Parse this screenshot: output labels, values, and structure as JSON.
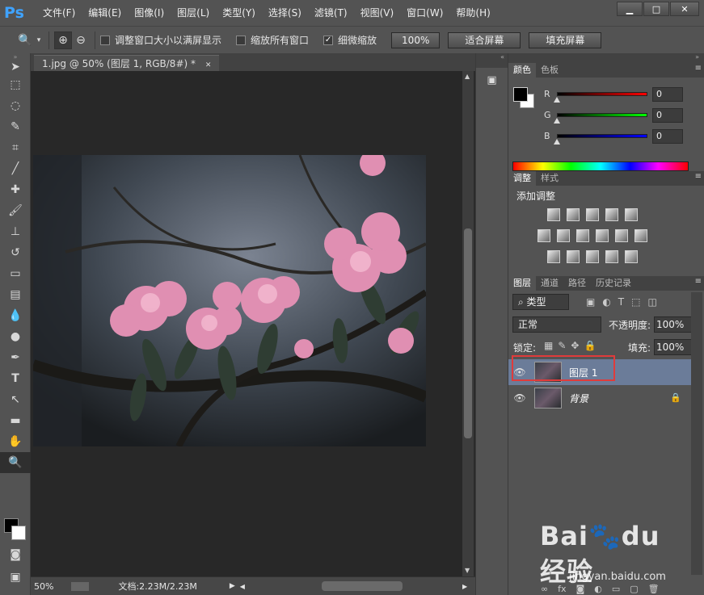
{
  "app": {
    "logo": "Ps"
  },
  "menu": [
    "文件(F)",
    "编辑(E)",
    "图像(I)",
    "图层(L)",
    "类型(Y)",
    "选择(S)",
    "滤镜(T)",
    "视图(V)",
    "窗口(W)",
    "帮助(H)"
  ],
  "window_controls": {
    "minimize": "▁",
    "maximize": "□",
    "close": "✕"
  },
  "options": {
    "resize_windows": "调整窗口大小以满屏显示",
    "zoom_all": "缩放所有窗口",
    "scrubby_zoom": "细微缩放",
    "zoom_pct": "100%",
    "fit_screen": "适合屏幕",
    "fill_screen": "填充屏幕"
  },
  "document": {
    "tab_title": "1.jpg @ 50% (图层 1, RGB/8#) *",
    "close": "✕",
    "zoom": "50%",
    "doc_info": "文档:2.23M/2.23M"
  },
  "color_panel": {
    "tabs": [
      "颜色",
      "色板"
    ],
    "channels": [
      {
        "label": "R",
        "value": "0",
        "color": "#d02020"
      },
      {
        "label": "G",
        "value": "0",
        "color": "#20b020"
      },
      {
        "label": "B",
        "value": "0",
        "color": "#2030c8"
      }
    ]
  },
  "adjust_panel": {
    "tabs": [
      "调整",
      "样式"
    ],
    "title": "添加调整"
  },
  "layers_panel": {
    "tabs": [
      "图层",
      "通道",
      "路径",
      "历史记录"
    ],
    "filter": "类型",
    "blend_mode": "正常",
    "opacity_label": "不透明度:",
    "opacity": "100%",
    "lock_label": "锁定:",
    "fill_label": "填充:",
    "fill": "100%",
    "layers": [
      {
        "name": "图层 1",
        "selected": true
      },
      {
        "name": "背景",
        "selected": false,
        "locked": true
      }
    ]
  },
  "watermark": {
    "brand": "Bai du 经验",
    "url": "jingyan.baidu.com"
  },
  "accent_colors": {
    "selection": "#6b7c99",
    "highlight": "#e03b3b",
    "ps_blue": "#3fa3ff"
  }
}
